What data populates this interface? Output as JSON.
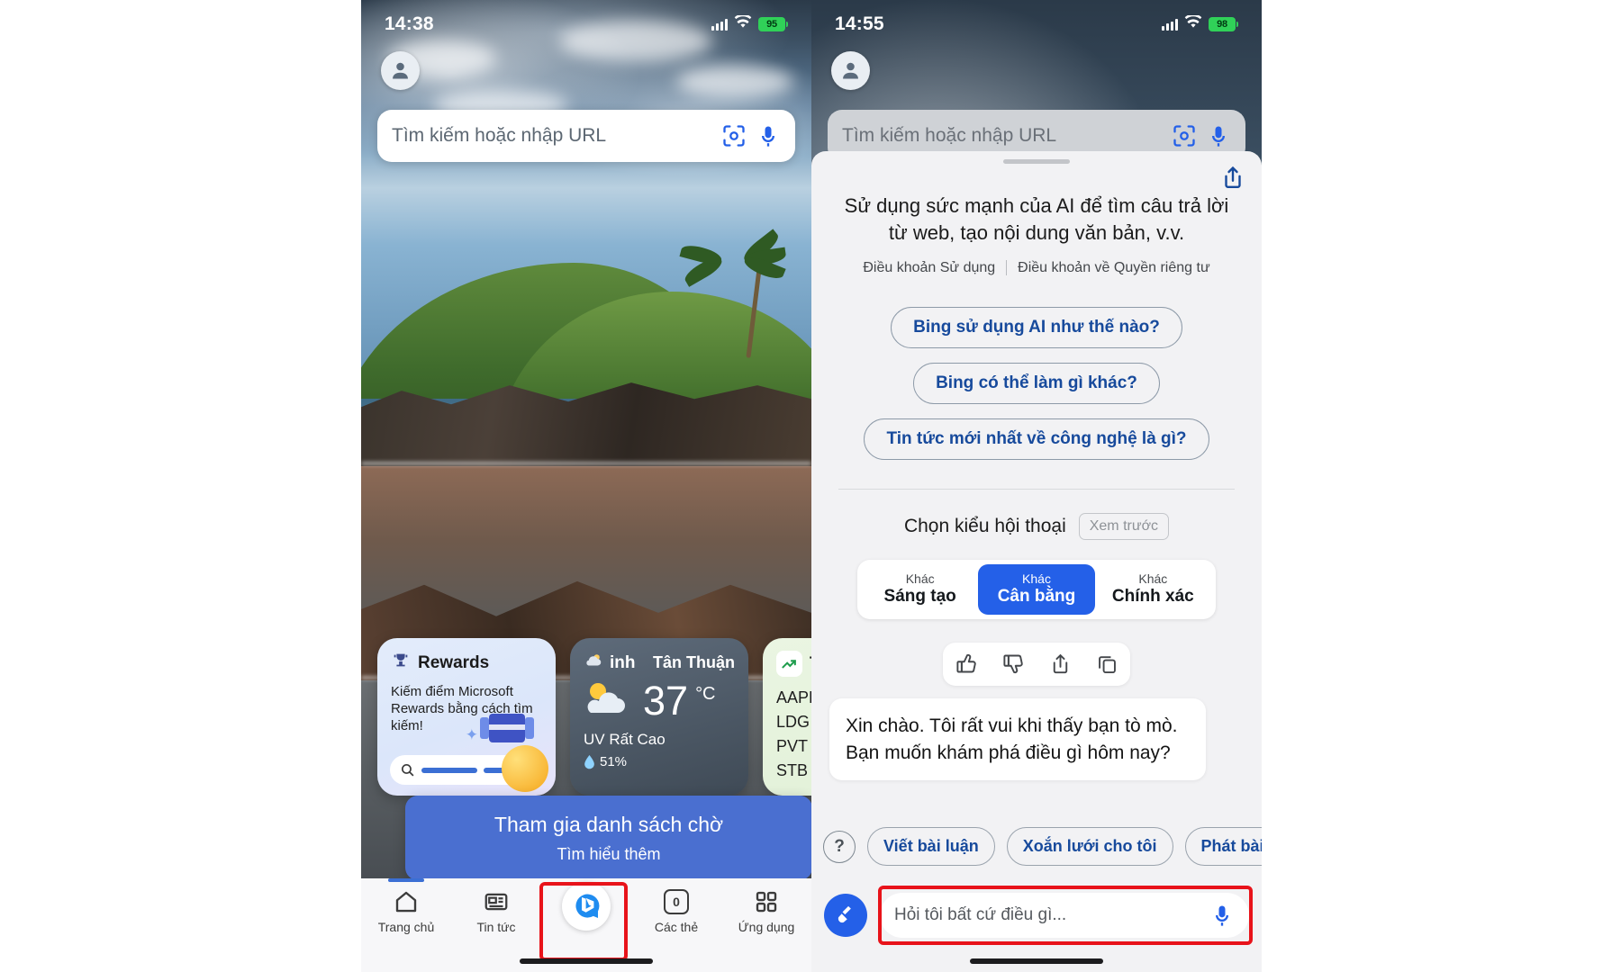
{
  "left_phone": {
    "status_bar": {
      "time": "14:38",
      "battery": "95",
      "signal_icon": "cellular-bars-icon",
      "wifi_icon": "wifi-icon"
    },
    "avatar_icon": "account-avatar-icon",
    "search": {
      "placeholder": "Tìm kiếm hoặc nhập URL",
      "lens_icon": "visual-search-icon",
      "mic_icon": "microphone-icon"
    },
    "cards": [
      {
        "id": "rewards",
        "icon": "rewards-trophy-icon",
        "title": "Rewards",
        "body": "Kiếm điểm Microsoft Rewards bằng cách tìm kiếm!",
        "mini_search_icon": "search-icon"
      },
      {
        "id": "weather",
        "icon": "weather-cloud-icon",
        "title": "inh",
        "city": "Tân Thuận",
        "temp": "37",
        "unit": "°C",
        "uv": "UV Rất Cao",
        "humidity": "51%",
        "humidity_icon": "water-drop-icon"
      },
      {
        "id": "stocks",
        "icon": "stocks-trending-icon",
        "title": "T",
        "tickers": [
          "AAPL",
          "LDG",
          "PVT",
          "STB"
        ]
      }
    ],
    "waitlist": {
      "title": "Tham gia danh sách chờ",
      "subtitle": "Tìm hiểu thêm"
    },
    "nav": [
      {
        "label": "Trang chủ",
        "icon": "home-icon",
        "active": true
      },
      {
        "label": "Tin tức",
        "icon": "news-icon",
        "active": false
      },
      {
        "label": "",
        "icon": "bing-chat-icon",
        "active": false,
        "highlight": true
      },
      {
        "label": "Các thẻ",
        "icon": "tabs-icon",
        "badge": "0",
        "active": false
      },
      {
        "label": "Ứng dụng",
        "icon": "apps-grid-icon",
        "active": false
      }
    ]
  },
  "right_phone": {
    "status_bar": {
      "time": "14:55",
      "battery": "98",
      "signal_icon": "cellular-bars-icon",
      "wifi_icon": "wifi-icon"
    },
    "avatar_icon": "account-avatar-icon",
    "search": {
      "placeholder": "Tìm kiếm hoặc nhập URL",
      "lens_icon": "visual-search-icon",
      "mic_icon": "microphone-icon"
    },
    "sheet": {
      "grabber": "drag-handle",
      "share_icon": "share-icon",
      "intro": "Sử dụng sức mạnh của AI để tìm câu trả lời từ web, tạo nội dung văn bản, v.v.",
      "legal_links": [
        "Điều khoản Sử dụng",
        "Điều khoản về Quyền riêng tư"
      ],
      "suggestion_chips": [
        "Bing sử dụng AI như thế nào?",
        "Bing có thể làm gì khác?",
        "Tin tức mới nhất về công nghệ là gì?"
      ],
      "style": {
        "label": "Chọn kiểu hội thoại",
        "preview_badge": "Xem trước",
        "options": [
          {
            "small": "Khác",
            "big": "Sáng tạo",
            "active": false
          },
          {
            "small": "Khác",
            "big": "Cân bằng",
            "active": true
          },
          {
            "small": "Khác",
            "big": "Chính xác",
            "active": false
          }
        ],
        "active_color": "#2460e8"
      },
      "reactions": [
        "thumbs-up-icon",
        "thumbs-down-icon",
        "share-icon",
        "copy-icon"
      ],
      "message": "Xin chào. Tôi rất vui khi thấy bạn tò mò. Bạn muốn khám phá điều gì hôm nay?",
      "prompt_help_icon": "question-mark-icon",
      "prompt_chips": [
        "Viết bài luận",
        "Xoắn lưới cho tôi",
        "Phát bài"
      ],
      "composer": {
        "broom_icon": "new-topic-broom-icon",
        "placeholder": "Hỏi tôi bất cứ điều gì...",
        "mic_icon": "microphone-icon"
      }
    }
  },
  "annotations": {
    "highlight_color": "#e8131a",
    "boxes": [
      "bing-chat-nav-button",
      "chat-input-box"
    ]
  }
}
